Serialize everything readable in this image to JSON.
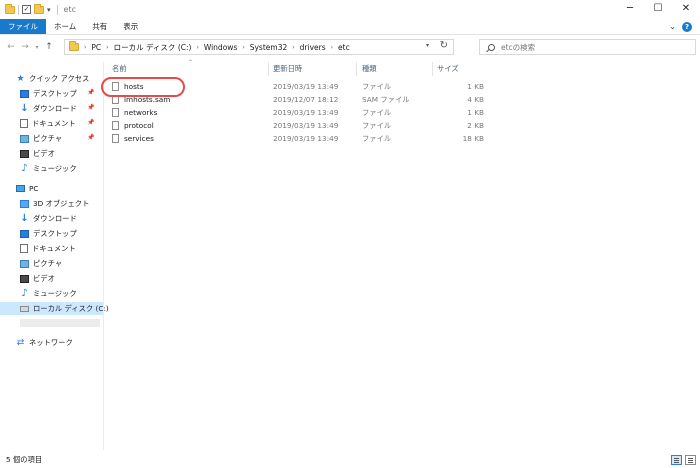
{
  "titlebar": {
    "title": "etc",
    "minimize": "─",
    "maximize": "☐",
    "close": "✕"
  },
  "ribbon": {
    "tabs": [
      "ファイル",
      "ホーム",
      "共有",
      "表示"
    ]
  },
  "address": {
    "crumbs": [
      "PC",
      "ローカル ディスク (C:)",
      "Windows",
      "System32",
      "drivers",
      "etc"
    ]
  },
  "search": {
    "placeholder": "etcの検索"
  },
  "nav": {
    "quick_access": "クイック アクセス",
    "quick_items": [
      "デスクトップ",
      "ダウンロード",
      "ドキュメント",
      "ピクチャ",
      "ビデオ",
      "ミュージック"
    ],
    "pc": "PC",
    "pc_items": [
      "3D オブジェクト",
      "ダウンロード",
      "デスクトップ",
      "ドキュメント",
      "ピクチャ",
      "ビデオ",
      "ミュージック",
      "ローカル ディスク (C:)"
    ],
    "network": "ネットワーク"
  },
  "columns": {
    "name": "名前",
    "date": "更新日時",
    "type": "種類",
    "size": "サイズ"
  },
  "files": [
    {
      "name": "hosts",
      "date": "2019/03/19 13:49",
      "type": "ファイル",
      "size": "1 KB"
    },
    {
      "name": "lmhosts.sam",
      "date": "2019/12/07 18:12",
      "type": "SAM ファイル",
      "size": "4 KB"
    },
    {
      "name": "networks",
      "date": "2019/03/19 13:49",
      "type": "ファイル",
      "size": "1 KB"
    },
    {
      "name": "protocol",
      "date": "2019/03/19 13:49",
      "type": "ファイル",
      "size": "2 KB"
    },
    {
      "name": "services",
      "date": "2019/03/19 13:49",
      "type": "ファイル",
      "size": "18 KB"
    }
  ],
  "status": {
    "item_count": "5 個の項目"
  }
}
